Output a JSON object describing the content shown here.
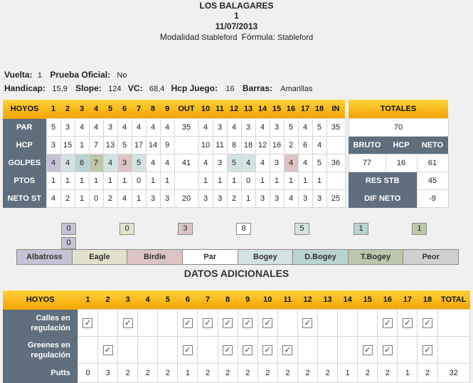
{
  "header": {
    "course": "LOS BALAGARES",
    "round_no": "1",
    "date": "11/07/2013",
    "modalidad_label": "Modalidad",
    "modalidad_value": "Stableford",
    "formula_label": "Fórmula:",
    "formula_value": "Stableford"
  },
  "info": {
    "vuelta_label": "Vuelta:",
    "vuelta_value": "1",
    "prueba_label": "Prueba Oficial:",
    "prueba_value": "No",
    "handicap_label": "Handicap:",
    "handicap_value": "15,9",
    "slope_label": "Slope:",
    "slope_value": "124",
    "vc_label": "VC:",
    "vc_value": "68,4",
    "hcpjuego_label": "Hcp Juego:",
    "hcpjuego_value": "16",
    "barras_label": "Barras:",
    "barras_value": "Amarillas"
  },
  "scorecard": {
    "hoyos_label": "HOYOS",
    "out_label": "OUT",
    "in_label": "IN",
    "totales_label": "TOTALES",
    "holes_front": [
      "1",
      "2",
      "3",
      "4",
      "5",
      "6",
      "7",
      "8",
      "9"
    ],
    "holes_back": [
      "10",
      "11",
      "12",
      "13",
      "14",
      "15",
      "16",
      "17",
      "18"
    ],
    "rows": [
      {
        "label": "PAR",
        "front": [
          "5",
          "3",
          "4",
          "4",
          "3",
          "4",
          "4",
          "4",
          "4"
        ],
        "out": "35",
        "back": [
          "4",
          "3",
          "4",
          "3",
          "4",
          "3",
          "5",
          "4",
          "5"
        ],
        "in": "35"
      },
      {
        "label": "HCP",
        "front": [
          "3",
          "15",
          "1",
          "7",
          "13",
          "5",
          "17",
          "14",
          "9"
        ],
        "out": "",
        "back": [
          "10",
          "11",
          "8",
          "18",
          "12",
          "16",
          "2",
          "6",
          "4"
        ],
        "in": ""
      },
      {
        "label": "GOLPES",
        "front": [
          "4",
          "4",
          "6",
          "7",
          "4",
          "3",
          "5",
          "4",
          "4"
        ],
        "out": "41",
        "back": [
          "4",
          "3",
          "5",
          "4",
          "4",
          "3",
          "4",
          "4",
          "5"
        ],
        "in": "36"
      },
      {
        "label": "PTOS",
        "front": [
          "1",
          "1",
          "1",
          "1",
          "1",
          "1",
          "0",
          "1",
          "1"
        ],
        "out": "",
        "back": [
          "1",
          "1",
          "1",
          "0",
          "1",
          "1",
          "1",
          "1",
          "1"
        ],
        "in": ""
      },
      {
        "label": "NETO ST",
        "front": [
          "4",
          "2",
          "1",
          "0",
          "2",
          "4",
          "1",
          "3",
          "3"
        ],
        "out": "20",
        "back": [
          "3",
          "3",
          "2",
          "1",
          "3",
          "3",
          "4",
          "3",
          "3"
        ],
        "in": "25"
      }
    ],
    "golpes_colors_front": [
      "alb",
      "bog",
      "dbog",
      "tbog",
      "bog",
      "bir",
      "bog",
      "par",
      "par"
    ],
    "golpes_colors_back": [
      "par",
      "par",
      "bog",
      "bog",
      "par",
      "par",
      "bir",
      "par",
      "par"
    ],
    "totales": {
      "par_total": "70",
      "bruto_label": "BRUTO",
      "hcp_label": "HCP",
      "neto_label": "NETO",
      "bruto": "77",
      "hcp": "16",
      "neto": "61",
      "res_stb_label": "RES STB",
      "res_stb": "45",
      "dif_neto_label": "DIF NETO",
      "dif_neto": "-9"
    }
  },
  "counts": {
    "albatross": "0",
    "albatross2": "0",
    "eagle": "0",
    "birdie": "3",
    "par": "8",
    "bogey": "5",
    "dbogey": "1",
    "tbogey": "1"
  },
  "legend": [
    "Albatross",
    "Eagle",
    "Birdie",
    "Par",
    "Bogey",
    "D.Bogey",
    "T.Bogey",
    "Peor"
  ],
  "datos": {
    "title": "DATOS ADICIONALES",
    "hoyos_label": "HOYOS",
    "total_label": "TOTAL",
    "holes": [
      "1",
      "2",
      "3",
      "4",
      "5",
      "6",
      "7",
      "8",
      "9",
      "10",
      "11",
      "12",
      "13",
      "14",
      "15",
      "16",
      "17",
      "18"
    ],
    "calles_label": "Calles en regulación",
    "greenes_label": "Greenes en regulación",
    "putts_label": "Putts",
    "calles": [
      1,
      0,
      1,
      0,
      0,
      1,
      1,
      1,
      1,
      1,
      0,
      1,
      0,
      0,
      0,
      1,
      1,
      1
    ],
    "greenes": [
      0,
      1,
      0,
      0,
      0,
      1,
      0,
      1,
      1,
      1,
      1,
      0,
      0,
      0,
      1,
      1,
      0,
      1
    ],
    "putts": [
      "0",
      "3",
      "2",
      "2",
      "2",
      "1",
      "2",
      "2",
      "2",
      "2",
      "2",
      "2",
      "2",
      "1",
      "2",
      "2",
      "1",
      "2"
    ],
    "putts_total": "32",
    "check_glyph": "✓"
  }
}
